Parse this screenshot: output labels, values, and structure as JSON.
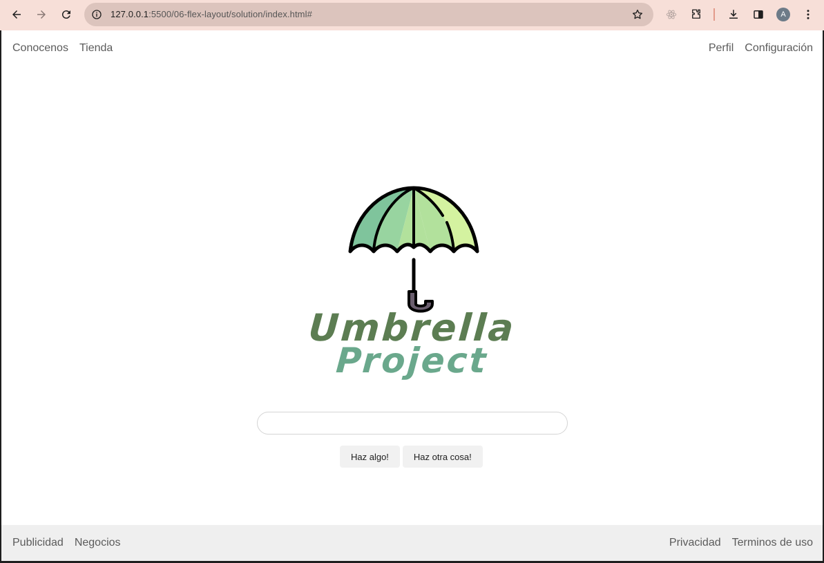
{
  "browser": {
    "url_host": "127.0.0.1",
    "url_path": ":5500/06-flex-layout/solution/index.html#",
    "avatar_letter": "A",
    "icons": [
      "back-icon",
      "forward-icon",
      "reload-icon",
      "info-icon",
      "star-icon",
      "react-devtools-icon",
      "extensions-icon",
      "download-icon",
      "sidepanel-icon",
      "menu-icon"
    ]
  },
  "topnav": {
    "left": [
      {
        "label": "Conocenos"
      },
      {
        "label": "Tienda"
      }
    ],
    "right": [
      {
        "label": "Perfil"
      },
      {
        "label": "Configuración"
      }
    ]
  },
  "brand": {
    "line1": "Umbrella",
    "line2": "Project",
    "colors": {
      "line1": "#5c7d52",
      "line2": "#6aa88c"
    }
  },
  "search": {
    "value": "",
    "placeholder": ""
  },
  "buttons": {
    "primary": "Haz algo!",
    "secondary": "Haz otra cosa!"
  },
  "footer": {
    "left": [
      {
        "label": "Publicidad"
      },
      {
        "label": "Negocios"
      }
    ],
    "right": [
      {
        "label": "Privacidad"
      },
      {
        "label": "Terminos de uso"
      }
    ]
  }
}
